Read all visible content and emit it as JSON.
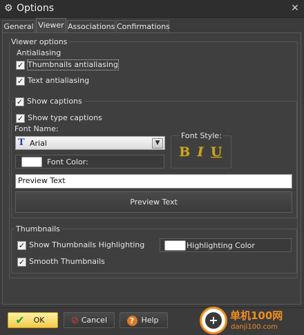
{
  "window": {
    "title": "Options",
    "icon": "gear-icon",
    "close_glyph": "✕"
  },
  "tabs": [
    {
      "label": "General",
      "active": false
    },
    {
      "label": "Viewer",
      "active": true
    },
    {
      "label": "Associations",
      "active": false
    },
    {
      "label": "Confirmations",
      "active": false
    }
  ],
  "viewer": {
    "group_title": "Viewer options",
    "antialiasing": {
      "title": "Antialiasing",
      "thumbnails_label": "Thumbnails antialiasing",
      "thumbnails_checked": true,
      "text_label": "Text antialiasing",
      "text_checked": true
    },
    "captions": {
      "show_captions_label": "Show captions",
      "show_captions_checked": true,
      "show_type_label": "Show type captions",
      "show_type_checked": true,
      "font_name_label": "Font Name:",
      "font_name_value": "Arial",
      "font_color_label": "Font Color:",
      "font_color": "#ffffff",
      "font_style_label": "Font Style:",
      "style_bold": "B",
      "style_italic": "I",
      "style_underline": "U",
      "preview_text_value": "Preview Text",
      "preview_button_label": "Preview Text"
    },
    "thumbnails": {
      "title": "Thumbnails",
      "show_highlighting_label": "Show Thumbnails Highlighting",
      "show_highlighting_checked": true,
      "highlighting_color_label": "Highlighting Color",
      "highlighting_color": "#ffffff",
      "smooth_label": "Smooth Thumbnails",
      "smooth_checked": true
    }
  },
  "footer": {
    "ok_label": "OK",
    "cancel_label": "Cancel",
    "help_label": "Help"
  },
  "watermark": {
    "cn": "单机100网",
    "url": "danji100.com"
  },
  "colors": {
    "accent_ok": "#f0c94a",
    "style_gold": "#c9a227",
    "background": "#3b3b3b"
  }
}
